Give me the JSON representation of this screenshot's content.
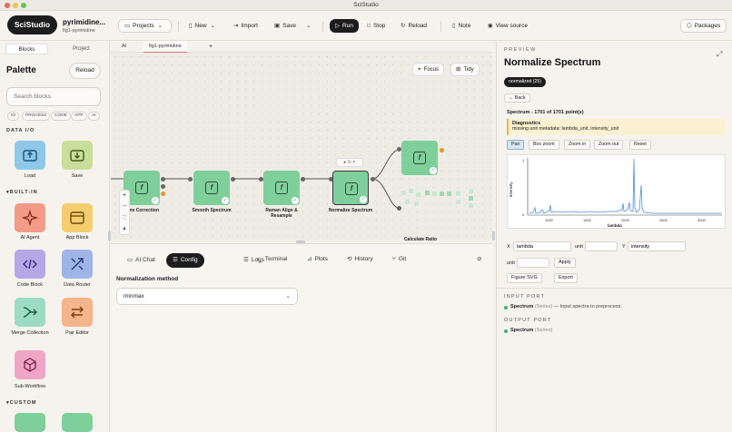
{
  "window": {
    "title": "SciStudio"
  },
  "header": {
    "logo": "SciStudio",
    "project_name": "pyrimidine...",
    "project_sub": "fig1-pyrimidine",
    "projects_label": "Projects",
    "new_label": "New",
    "import_label": "Import",
    "save_label": "Save",
    "run_label": "Run",
    "stop_label": "Stop",
    "reload_label": "Reload",
    "note_label": "Note",
    "view_source_label": "View source",
    "packages_label": "Packages"
  },
  "sidebar": {
    "tabs": [
      "Blocks",
      "Project"
    ],
    "palette_title": "Palette",
    "reload_label": "Reload",
    "search_placeholder": "Search blocks",
    "filters": [
      "IO",
      "PROCESS",
      "CODE",
      "APP",
      "AI"
    ],
    "section_io": "DATA I/O",
    "section_builtin": "BUILT-IN",
    "section_custom": "CUSTOM",
    "io_blocks": [
      "Load",
      "Save"
    ],
    "builtin_blocks": [
      "AI Agent",
      "App Block",
      "Code Block",
      "Data Router",
      "Merge Collection",
      "Pair Editor",
      "Sub-Workflow"
    ]
  },
  "canvas": {
    "tabs": [
      "AI",
      "fig1-pyrimidine"
    ],
    "add_tab": "+",
    "focus_label": "Focus",
    "tidy_label": "Tidy",
    "nodes": [
      "aline Correction",
      "Smooth Spectrum",
      "Raman Align & Resample",
      "Normalize Spectrum",
      "Calculate Ratio"
    ],
    "zoom": [
      "+",
      "−"
    ]
  },
  "bottom": {
    "tabs": [
      "AI Chat",
      "Config",
      "Logs",
      "Terminal",
      "Plots",
      "History",
      "Git"
    ],
    "norm_label": "Normalization method",
    "norm_value": "minmax"
  },
  "preview": {
    "label": "PREVIEW",
    "title": "Normalize Spectrum",
    "badge": "normalized (25)",
    "back_label": "Back",
    "spectrum_title": "Spectrum - 1701 of 1701 point(s)",
    "diag_title": "Diagnostics",
    "diag_text": "missing unit metadata: lambda_unit, intensity_unit",
    "plot_buttons": [
      "Pan",
      "Box zoom",
      "Zoom in",
      "Zoom out",
      "Reset"
    ],
    "x_label": "X",
    "x_value": "lambda",
    "unit_label": "unit",
    "y_label": "Y",
    "y_value": "intensity",
    "apply_label": "Apply",
    "figure_svg_label": "Figure SVG",
    "export_label": "Export",
    "input_port_title": "INPUT PORT",
    "input_port_name": "Spectrum",
    "input_port_type": "(Series)",
    "input_port_desc": "— Input spectra to preprocess.",
    "output_port_title": "OUTPUT PORT",
    "output_port_name": "Spectrum",
    "output_port_type": "(Series)",
    "plot": {
      "xlabel": "lambda",
      "ylabel": "intensity",
      "x_ticks": [
        "1000",
        "1500",
        "2000",
        "2500",
        "3000"
      ],
      "y_ticks": [
        "0",
        "1"
      ]
    }
  },
  "colors": {
    "node": "#7fcf9a",
    "accent_dark": "#1d1d1d",
    "line": "#4a8fd6"
  }
}
